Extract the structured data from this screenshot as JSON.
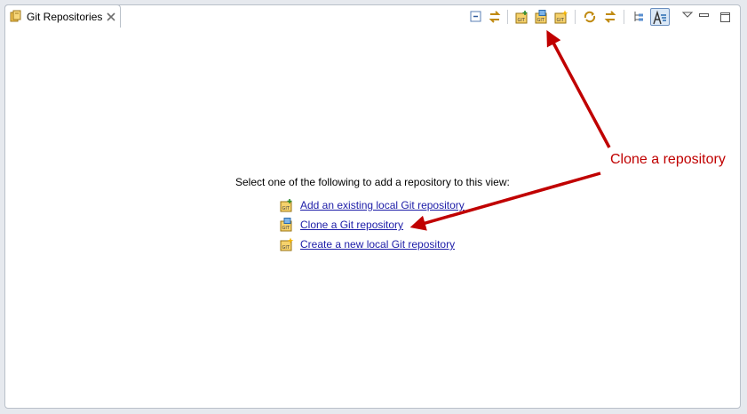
{
  "view": {
    "tab_title": "Git Repositories",
    "tab_icon": "git-repositories-icon",
    "close_icon": "close-icon"
  },
  "toolbar": {
    "buttons": [
      {
        "name": "collapse-all-icon"
      },
      {
        "name": "link-with-selection-icon"
      },
      {
        "name": "add-existing-repository-icon"
      },
      {
        "name": "clone-repository-icon"
      },
      {
        "name": "create-repository-icon"
      },
      {
        "name": "refresh-icon"
      },
      {
        "name": "link-with-editor-icon"
      },
      {
        "name": "hierarchical-branch-layout-icon"
      },
      {
        "name": "filter-icon",
        "active": true
      },
      {
        "name": "view-menu-icon"
      },
      {
        "name": "minimize-icon"
      },
      {
        "name": "maximize-icon"
      }
    ]
  },
  "main": {
    "instruction": "Select one of the following to add a repository to this view:",
    "links": [
      {
        "label": "Add an existing local Git repository",
        "icon": "add-repository-icon"
      },
      {
        "label": "Clone a Git repository",
        "icon": "clone-repository-icon"
      },
      {
        "label": "Create a new local Git repository",
        "icon": "create-repository-icon"
      }
    ]
  },
  "annotation": {
    "callout": "Clone a repository",
    "color": "#c00000"
  },
  "colors": {
    "link": "#1d1da8",
    "frame_border": "#b9c0c9",
    "background": "#e6e9ee"
  }
}
